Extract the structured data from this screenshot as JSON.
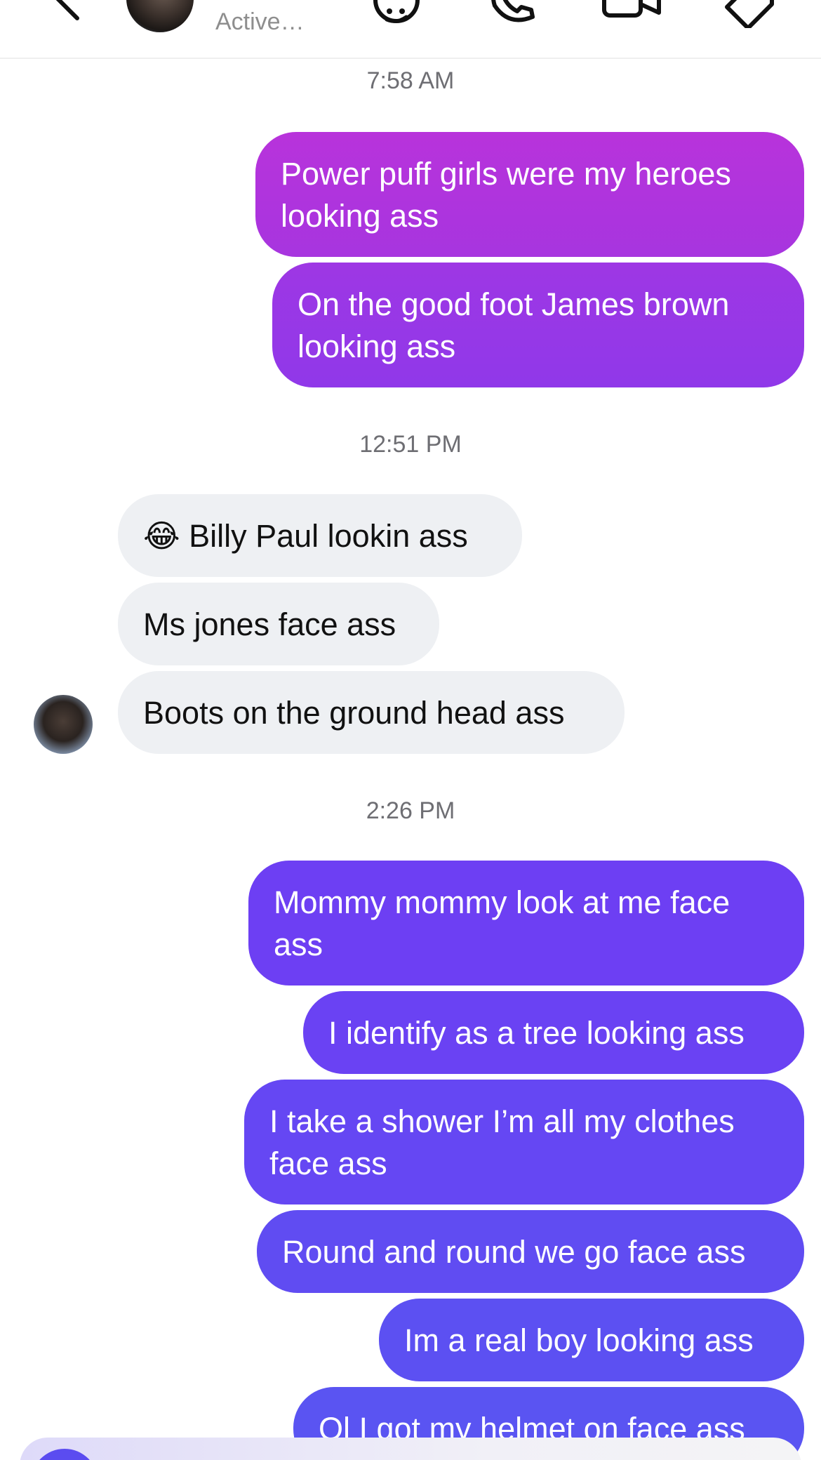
{
  "header": {
    "status": "Active…",
    "icons": [
      "back-chevron-icon",
      "sticker-icon",
      "phone-icon",
      "video-camera-icon",
      "tag-icon"
    ]
  },
  "timestamps": [
    "7:58 AM",
    "12:51 PM",
    "2:26 PM"
  ],
  "messages": {
    "group1": [
      "Power puff girls were my heroes\nlooking ass",
      "On the good foot James brown\nlooking ass"
    ],
    "group2": [
      "😂 Billy Paul lookin ass",
      "Ms jones face ass",
      "Boots on the ground head ass"
    ],
    "group3": [
      "Mommy mommy look at me face\nass",
      "I identify as a tree looking ass",
      "I take a shower I’m all my clothes\nface ass",
      "Round and round we go face ass",
      "Im a real boy looking ass",
      "Ol I got my helmet on face ass"
    ]
  },
  "colors": {
    "sent_pink": "#b233dc",
    "sent_violet": "#6d3ff3",
    "sent_blue": "#5a52f2",
    "received_bg": "#eef0f3"
  }
}
